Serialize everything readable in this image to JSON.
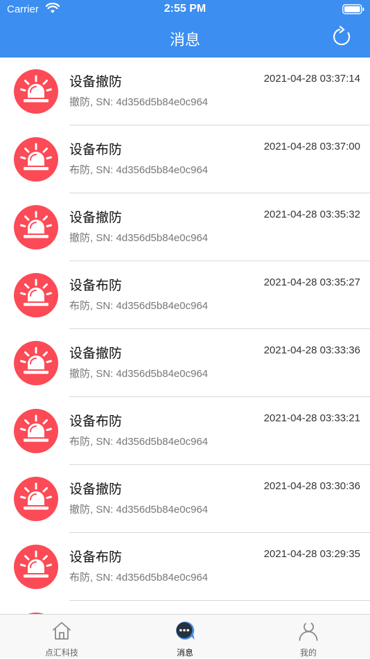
{
  "status_bar": {
    "carrier": "Carrier",
    "time": "2:55 PM"
  },
  "header": {
    "title": "消息",
    "refresh_icon": "refresh-icon"
  },
  "colors": {
    "header": "#3c8ef0",
    "alarm": "#fc4a56",
    "active_tab": "#3c8ef0"
  },
  "messages": [
    {
      "title": "设备撤防",
      "time": "2021-04-28 03:37:14",
      "desc": "撤防, SN: 4d356d5b84e0c964"
    },
    {
      "title": "设备布防",
      "time": "2021-04-28 03:37:00",
      "desc": "布防, SN: 4d356d5b84e0c964"
    },
    {
      "title": "设备撤防",
      "time": "2021-04-28 03:35:32",
      "desc": "撤防, SN: 4d356d5b84e0c964"
    },
    {
      "title": "设备布防",
      "time": "2021-04-28 03:35:27",
      "desc": "布防, SN: 4d356d5b84e0c964"
    },
    {
      "title": "设备撤防",
      "time": "2021-04-28 03:33:36",
      "desc": "撤防, SN: 4d356d5b84e0c964"
    },
    {
      "title": "设备布防",
      "time": "2021-04-28 03:33:21",
      "desc": "布防, SN: 4d356d5b84e0c964"
    },
    {
      "title": "设备撤防",
      "time": "2021-04-28 03:30:36",
      "desc": "撤防, SN: 4d356d5b84e0c964"
    },
    {
      "title": "设备布防",
      "time": "2021-04-28 03:29:35",
      "desc": "布防, SN: 4d356d5b84e0c964"
    },
    {
      "title": "",
      "time": "",
      "desc": ""
    }
  ],
  "tabs": [
    {
      "label": "点汇科技",
      "icon": "home-icon"
    },
    {
      "label": "消息",
      "icon": "message-icon",
      "active": true
    },
    {
      "label": "我的",
      "icon": "profile-icon"
    }
  ]
}
